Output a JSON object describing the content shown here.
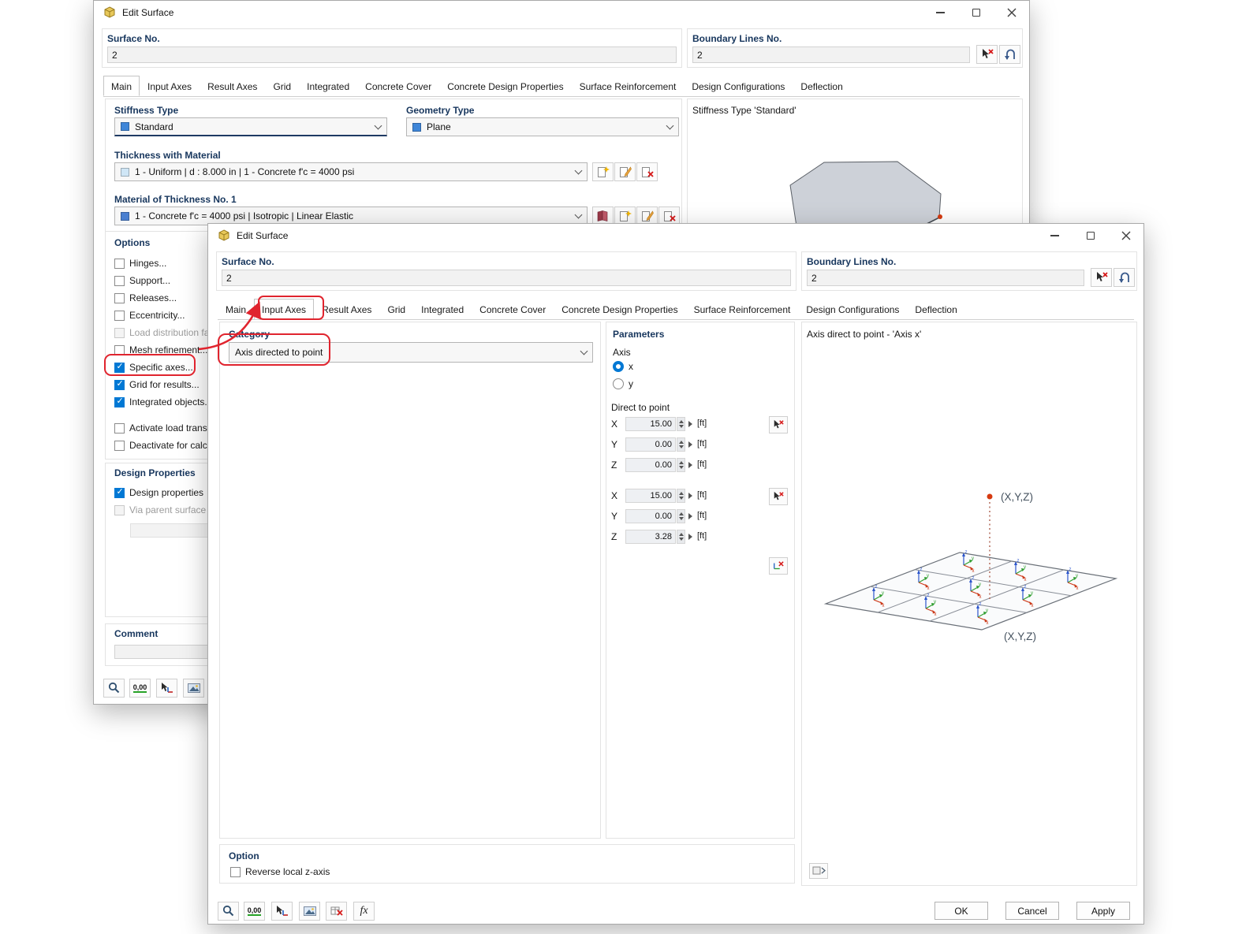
{
  "tabs": [
    "Main",
    "Input Axes",
    "Result Axes",
    "Grid",
    "Integrated",
    "Concrete Cover",
    "Concrete Design Properties",
    "Surface Reinforcement",
    "Design Configurations",
    "Deflection"
  ],
  "colors": {
    "annotation_red": "#e0242e",
    "accent_blue": "#0078d4",
    "label_navy": "#17365d"
  },
  "toolbar": {
    "units_display": "0,00",
    "fx_label": "fx"
  },
  "back_window": {
    "title": "Edit Surface",
    "surface_no": {
      "label": "Surface No.",
      "value": "2"
    },
    "boundary_lines": {
      "label": "Boundary Lines No.",
      "value": "2"
    },
    "active_tab": "Main",
    "main_tab": {
      "stiffness": {
        "label": "Stiffness Type",
        "value": "Standard"
      },
      "geometry": {
        "label": "Geometry Type",
        "value": "Plane"
      },
      "thickness": {
        "label": "Thickness with Material",
        "value": "1 - Uniform | d : 8.000 in | 1 - Concrete f'c = 4000 psi"
      },
      "material": {
        "label": "Material of Thickness No. 1",
        "value": "1 - Concrete f'c = 4000 psi | Isotropic | Linear Elastic"
      },
      "preview_title": "Stiffness Type 'Standard'"
    },
    "options": {
      "title": "Options",
      "items": [
        {
          "label": "Hinges...",
          "checked": false,
          "disabled": false
        },
        {
          "label": "Support...",
          "checked": false,
          "disabled": false
        },
        {
          "label": "Releases...",
          "checked": false,
          "disabled": false
        },
        {
          "label": "Eccentricity...",
          "checked": false,
          "disabled": false
        },
        {
          "label": "Load distribution fa",
          "checked": false,
          "disabled": true
        },
        {
          "label": "Mesh refinement...",
          "checked": false,
          "disabled": false
        },
        {
          "label": "Specific axes...",
          "checked": true,
          "disabled": false
        },
        {
          "label": "Grid for results...",
          "checked": true,
          "disabled": false
        },
        {
          "label": "Integrated objects..",
          "checked": true,
          "disabled": false
        },
        {
          "label": "Activate load transf",
          "checked": false,
          "disabled": false
        },
        {
          "label": "Deactivate for calcu",
          "checked": false,
          "disabled": false
        }
      ]
    },
    "design_properties": {
      "title": "Design Properties",
      "items": [
        {
          "label": "Design properties",
          "checked": true,
          "disabled": false
        },
        {
          "label": "Via parent surface s",
          "checked": false,
          "disabled": true
        }
      ]
    },
    "comment": {
      "label": "Comment",
      "value": ""
    }
  },
  "front_window": {
    "title": "Edit Surface",
    "surface_no": {
      "label": "Surface No.",
      "value": "2"
    },
    "boundary_lines": {
      "label": "Boundary Lines No.",
      "value": "2"
    },
    "active_tab": "Input Axes",
    "input_axes": {
      "category": {
        "label": "Category",
        "value": "Axis directed to point"
      },
      "parameters": {
        "title": "Parameters",
        "axis_label": "Axis",
        "axis_options": [
          {
            "label": "x",
            "selected": true
          },
          {
            "label": "y",
            "selected": false
          }
        ],
        "direct_to_point_label": "Direct to point",
        "point1": [
          {
            "axis": "X",
            "value": "15.00",
            "unit": "[ft]"
          },
          {
            "axis": "Y",
            "value": "0.00",
            "unit": "[ft]"
          },
          {
            "axis": "Z",
            "value": "0.00",
            "unit": "[ft]"
          }
        ],
        "point2": [
          {
            "axis": "X",
            "value": "15.00",
            "unit": "[ft]"
          },
          {
            "axis": "Y",
            "value": "0.00",
            "unit": "[ft]"
          },
          {
            "axis": "Z",
            "value": "3.28",
            "unit": "[ft]"
          }
        ]
      },
      "preview": {
        "title": "Axis direct to point - 'Axis x'",
        "point_label_top": "(X,Y,Z)",
        "point_label_bottom": "(X,Y,Z)"
      },
      "option": {
        "title": "Option",
        "reverse_label": "Reverse local z-axis",
        "checked": false
      }
    },
    "buttons": {
      "ok": "OK",
      "cancel": "Cancel",
      "apply": "Apply"
    }
  }
}
